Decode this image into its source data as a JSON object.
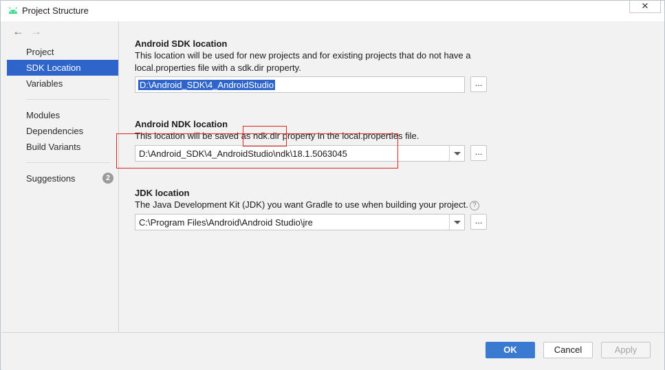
{
  "window": {
    "title": "Project Structure",
    "close_label": "✕"
  },
  "nav": {
    "back": "←",
    "forward": "→"
  },
  "sidebar": {
    "items": [
      {
        "label": "Project"
      },
      {
        "label": "SDK Location"
      },
      {
        "label": "Variables"
      },
      {
        "label": "Modules"
      },
      {
        "label": "Dependencies"
      },
      {
        "label": "Build Variants"
      },
      {
        "label": "Suggestions"
      }
    ],
    "suggestions_count": "2"
  },
  "sdk": {
    "title": "Android SDK location",
    "desc_line1": "This location will be used for new projects and for existing projects that do not have a",
    "desc_line2": "local.properties file with a sdk.dir property.",
    "value": "D:\\Android_SDK\\4_AndroidStudio",
    "browse": "..."
  },
  "ndk": {
    "title": "Android NDK location",
    "desc": "This location will be saved as ndk.dir property in the local.properties file.",
    "value": "D:\\Android_SDK\\4_AndroidStudio\\ndk\\18.1.5063045",
    "browse": "..."
  },
  "jdk": {
    "title": "JDK location",
    "desc": "The Java Development Kit (JDK) you want Gradle to use when building your project.",
    "help": "?",
    "value": "C:\\Program Files\\Android\\Android Studio\\jre",
    "browse": "..."
  },
  "buttons": {
    "ok": "OK",
    "cancel": "Cancel",
    "apply": "Apply"
  },
  "colors": {
    "accent": "#2f65ca",
    "annotation": "#e02424",
    "ok_button": "#3a7ad1"
  }
}
